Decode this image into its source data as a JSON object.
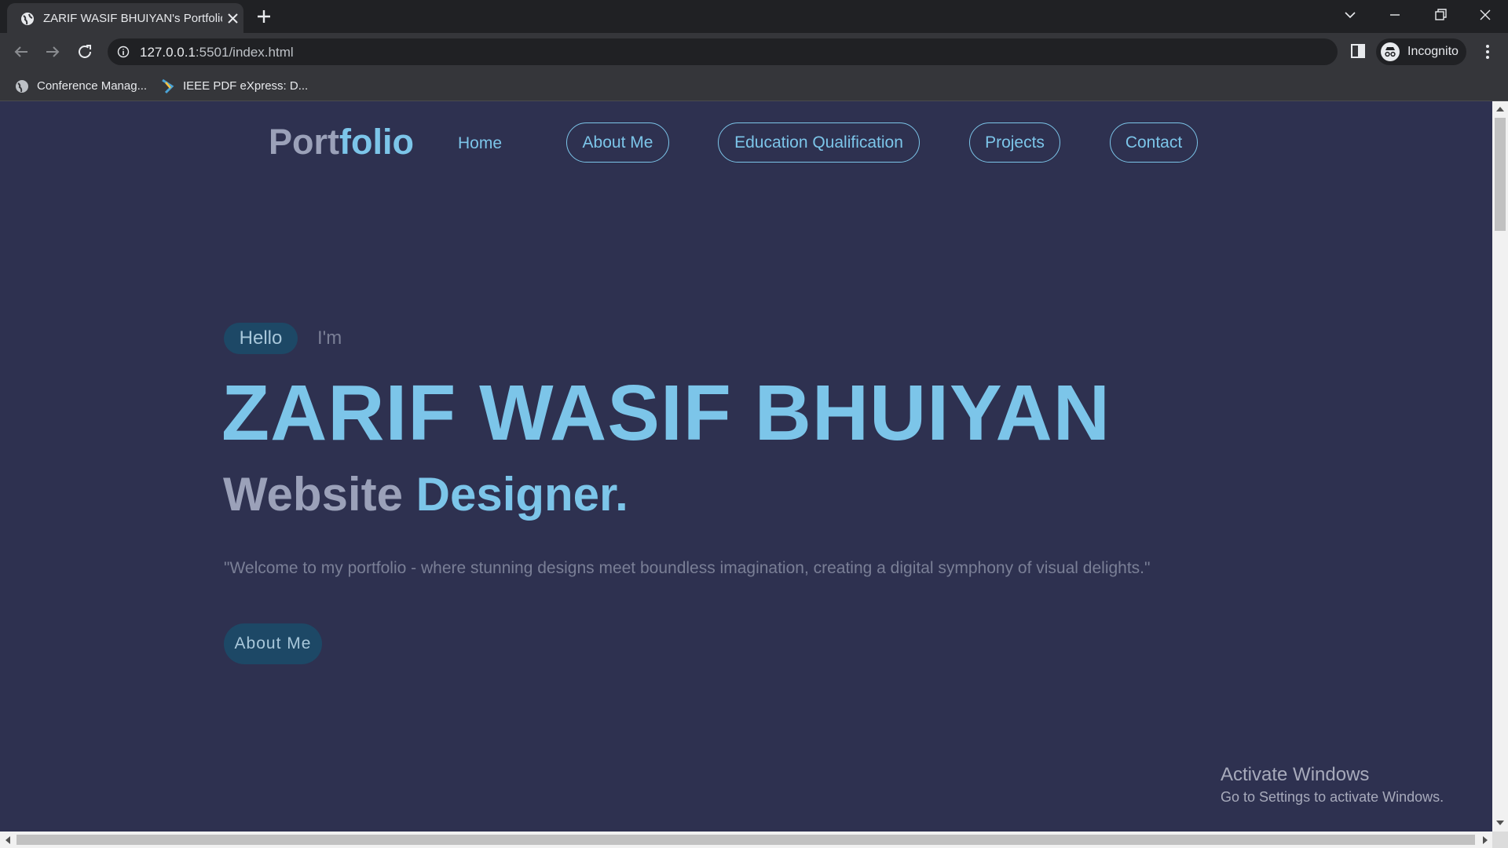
{
  "browser": {
    "tab_title": "ZARIF WASIF BHUIYAN's Portfolio",
    "url_host": "127.0.0.1",
    "url_rest": ":5501/index.html",
    "profile_label": "Incognito",
    "bookmarks": [
      {
        "label": "Conference Manag..."
      },
      {
        "label": "IEEE PDF eXpress: D..."
      }
    ]
  },
  "nav": {
    "logo_part1": "Port",
    "logo_part2": "folio",
    "home": "Home",
    "about": "About Me",
    "education": "Education Qualification",
    "projects": "Projects",
    "contact": "Contact"
  },
  "hero": {
    "hello": "Hello",
    "im": "I'm",
    "name": "ZARIF WASIF BHUIYAN",
    "role_part1": "Website",
    "role_part2": "Designer.",
    "quote": "\"Welcome to my portfolio - where stunning designs meet boundless imagination, creating a digital symphony of visual delights.\"",
    "cta": "About Me"
  },
  "watermark": {
    "title": "Activate Windows",
    "subtitle": "Go to Settings to activate Windows."
  },
  "colors": {
    "page_bg": "#2e3150",
    "accent": "#7cc5e9",
    "muted": "#9ba1b9",
    "pill_bg": "#1d4866"
  }
}
